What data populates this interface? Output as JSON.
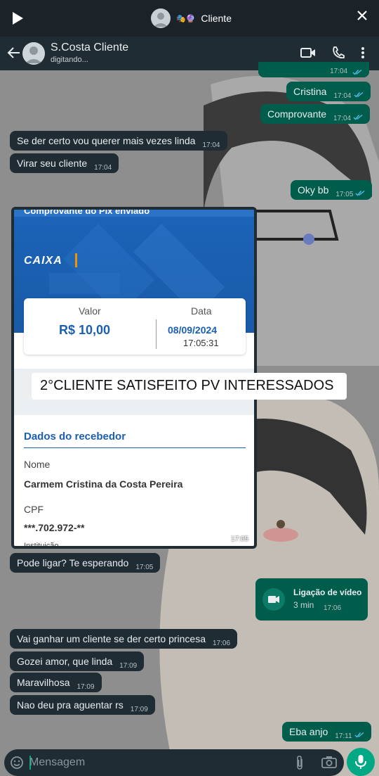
{
  "topbar": {
    "title": "Cliente",
    "badge_emoji": "🎭🔮"
  },
  "header": {
    "name": "S.Costa Cliente",
    "status": "digitando..."
  },
  "messages": [
    {
      "text": "Cristina",
      "time": "17:04"
    },
    {
      "text": "Comprovante",
      "time": "17:04"
    },
    {
      "text": "Se der certo vou querer mais vezes linda",
      "time": "17:04"
    },
    {
      "text": "Virar seu cliente",
      "time": "17:04"
    },
    {
      "text": "Oky bb",
      "time": "17:05"
    },
    {
      "text": "Pode ligar? Te esperando",
      "time": "17:05"
    },
    {
      "text": "Vai ganhar um cliente se der certo princesa",
      "time": "17:06"
    },
    {
      "text": "Gozei amor, que linda",
      "time": "17:09"
    },
    {
      "text": "Maravilhosa",
      "time": "17:09"
    },
    {
      "text": "Nao deu pra aguentar rs",
      "time": "17:09"
    },
    {
      "text": "Eba anjo",
      "time": "17:11"
    }
  ],
  "partial_top": {
    "time": "17:04"
  },
  "receipt": {
    "header_partial": "Comprovante do Pix enviado",
    "brand": "CAIXA",
    "valor_label": "Valor",
    "valor": "R$ 10,00",
    "data_label": "Data",
    "date": "08/09/2024",
    "time": "17:05:31",
    "section": "Dados do recebedor",
    "nome_label": "Nome",
    "nome": "Carmem Cristina da Costa Pereira",
    "cpf_label": "CPF",
    "cpf": "***.702.972-**",
    "partial_label": "Instituição",
    "msg_time": "17:05"
  },
  "overlay": {
    "text": "2°CLIENTE SATISFEITO PV INTERESSADOS"
  },
  "call": {
    "label": "Ligação de vídeo",
    "duration": "3 min",
    "time": "17:06"
  },
  "input": {
    "placeholder": "Mensagem"
  },
  "colors": {
    "incoming": "#1f2c34",
    "outgoing": "#005c4b",
    "accent": "#00a884",
    "caixa_blue": "#1b5fb0"
  }
}
